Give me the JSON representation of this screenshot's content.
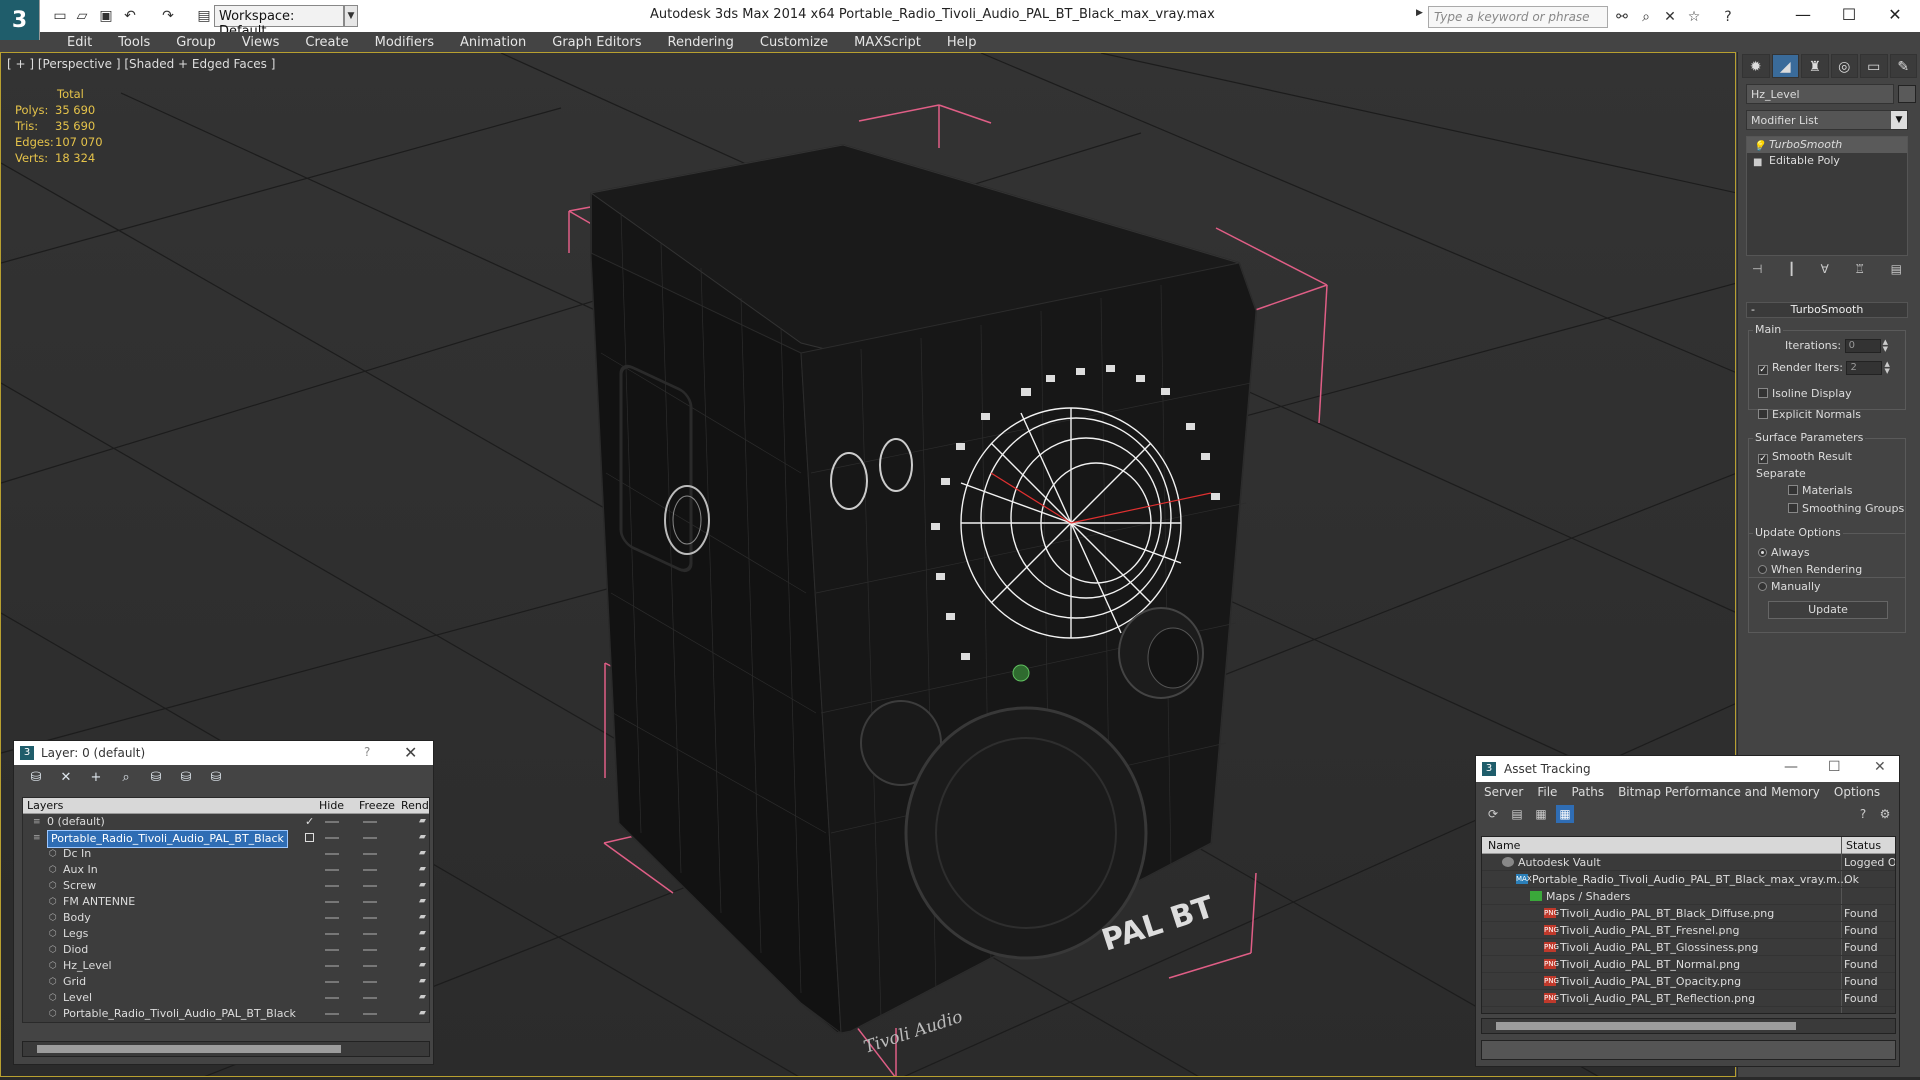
{
  "titlebar": {
    "app_title": "Autodesk 3ds Max  2014 x64      Portable_Radio_Tivoli_Audio_PAL_BT_Black_max_vray.max",
    "workspace": "Workspace: Default",
    "search_placeholder": "Type a keyword or phrase"
  },
  "menu": [
    "Edit",
    "Tools",
    "Group",
    "Views",
    "Create",
    "Modifiers",
    "Animation",
    "Graph Editors",
    "Rendering",
    "Customize",
    "MAXScript",
    "Help"
  ],
  "viewport": {
    "label": "[ + ] [Perspective ] [Shaded + Edged Faces ]",
    "stats_header": "Total",
    "stats": [
      {
        "label": "Polys:",
        "value": "35 690"
      },
      {
        "label": "Tris:",
        "value": "35 690"
      },
      {
        "label": "Edges:",
        "value": "107 070"
      },
      {
        "label": "Verts:",
        "value": "18 324"
      }
    ],
    "brand_front": "PAL BT",
    "brand_side": "Tivoli Audio"
  },
  "command_panel": {
    "object_name": "Hz_Level",
    "modifier_list": "Modifier List",
    "stack": [
      "TurboSmooth",
      "Editable Poly"
    ],
    "rollout_title": "TurboSmooth",
    "main_group": "Main",
    "iterations_label": "Iterations:",
    "iterations_value": "0",
    "render_iters_label": "Render Iters:",
    "render_iters_value": "2",
    "isoline_label": "Isoline Display",
    "explicit_normals_label": "Explicit Normals",
    "surface_group": "Surface Parameters",
    "smooth_result_label": "Smooth Result",
    "separate_label": "Separate",
    "materials_label": "Materials",
    "smoothing_groups_label": "Smoothing Groups",
    "update_group": "Update Options",
    "always_label": "Always",
    "when_rendering_label": "When Rendering",
    "manually_label": "Manually",
    "update_button": "Update"
  },
  "layer_dialog": {
    "title": "Layer: 0 (default)",
    "help": "?",
    "columns": {
      "layers": "Layers",
      "hide": "Hide",
      "freeze": "Freeze",
      "render": "Rende"
    },
    "rows": [
      {
        "name": "0 (default)",
        "indent": 0
      },
      {
        "name": "Portable_Radio_Tivoli_Audio_PAL_BT_Black",
        "indent": 0
      },
      {
        "name": "Dc In",
        "indent": 1
      },
      {
        "name": "Aux In",
        "indent": 1
      },
      {
        "name": "Screw",
        "indent": 1
      },
      {
        "name": "FM ANTENNE",
        "indent": 1
      },
      {
        "name": "Body",
        "indent": 1
      },
      {
        "name": "Legs",
        "indent": 1
      },
      {
        "name": "Diod",
        "indent": 1
      },
      {
        "name": "Hz_Level",
        "indent": 1
      },
      {
        "name": "Grid",
        "indent": 1
      },
      {
        "name": "Level",
        "indent": 1
      },
      {
        "name": "Portable_Radio_Tivoli_Audio_PAL_BT_Black",
        "indent": 1
      }
    ]
  },
  "asset_dialog": {
    "title": "Asset Tracking",
    "menu": [
      "Server",
      "File",
      "Paths",
      "Bitmap Performance and Memory",
      "Options"
    ],
    "columns": {
      "name": "Name",
      "status": "Status"
    },
    "rows": [
      {
        "name": "Autodesk Vault",
        "status": "Logged O",
        "icon": "vault",
        "indent": 1
      },
      {
        "name": "Portable_Radio_Tivoli_Audio_PAL_BT_Black_max_vray.m...",
        "status": "Ok",
        "icon": "max",
        "indent": 2
      },
      {
        "name": "Maps / Shaders",
        "status": "",
        "icon": "map",
        "indent": 3
      },
      {
        "name": "Tivoli_Audio_PAL_BT_Black_Diffuse.png",
        "status": "Found",
        "icon": "png",
        "indent": 4
      },
      {
        "name": "Tivoli_Audio_PAL_BT_Fresnel.png",
        "status": "Found",
        "icon": "png",
        "indent": 4
      },
      {
        "name": "Tivoli_Audio_PAL_BT_Glossiness.png",
        "status": "Found",
        "icon": "png",
        "indent": 4
      },
      {
        "name": "Tivoli_Audio_PAL_BT_Normal.png",
        "status": "Found",
        "icon": "png",
        "indent": 4
      },
      {
        "name": "Tivoli_Audio_PAL_BT_Opacity.png",
        "status": "Found",
        "icon": "png",
        "indent": 4
      },
      {
        "name": "Tivoli_Audio_PAL_BT_Reflection.png",
        "status": "Found",
        "icon": "png",
        "indent": 4
      }
    ]
  }
}
